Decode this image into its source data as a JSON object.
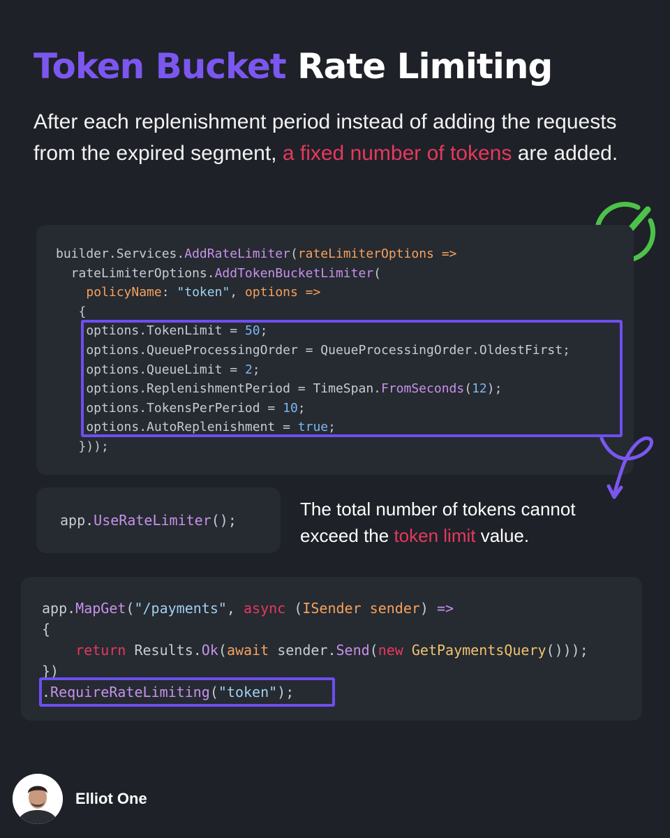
{
  "title": {
    "accent": "Token Bucket",
    "rest": "Rate Limiting"
  },
  "subtitle": {
    "part1": "After each replenishment period instead of adding the requests from the expired segment, ",
    "highlight": "a fixed number of tokens",
    "part2": " are added."
  },
  "note": {
    "part1": "The total number of tokens cannot exceed the ",
    "highlight": "token limit",
    "part2": " value."
  },
  "author": {
    "name": "Elliot One"
  },
  "colors": {
    "background": "#1e2127",
    "card": "#262a31",
    "accent_purple": "#7b57f0",
    "highlight_red": "#e5395e",
    "check_green": "#4cc24a"
  },
  "icons": [
    "check-circle-icon",
    "curly-arrow-icon"
  ],
  "code": {
    "block1": {
      "l1_obj": "builder.Services.",
      "l1_fn": "AddRateLimiter",
      "l1_paren": "(",
      "l1_param": "rateLimiterOptions =>",
      "l2_obj": "  rateLimiterOptions.",
      "l2_fn": "AddTokenBucketLimiter",
      "l2_paren": "(",
      "l3_indent": "    ",
      "l3_param": "policyName",
      "l3_colon": ": ",
      "l3_str": "\"token\"",
      "l3_comma": ", ",
      "l3_param2": "options =>",
      "l4": "   {",
      "l5_a": "    options.TokenLimit = ",
      "l5_num": "50",
      "l5_end": ";",
      "l6": "    options.QueueProcessingOrder = QueueProcessingOrder.OldestFirst;",
      "l7_a": "    options.QueueLimit = ",
      "l7_num": "2",
      "l7_end": ";",
      "l8_a": "    options.ReplenishmentPeriod = TimeSpan.",
      "l8_fn": "FromSeconds",
      "l8_p1": "(",
      "l8_num": "12",
      "l8_end": ");",
      "l9_a": "    options.TokensPerPeriod = ",
      "l9_num": "10",
      "l9_end": ";",
      "l10_a": "    options.AutoReplenishment = ",
      "l10_kw": "true",
      "l10_end": ";",
      "l11": "   }));"
    },
    "block2": {
      "obj": "app.",
      "fn": "UseRateLimiter",
      "end": "();"
    },
    "block3": {
      "l1_obj": "app.",
      "l1_fn": "MapGet",
      "l1_p": "(",
      "l1_str": "\"/payments\"",
      "l1_comma": ", ",
      "l1_kw": "async",
      "l1_sp": " (",
      "l1_type": "ISender sender",
      "l1_close": ") ",
      "l1_arrow": "=>",
      "l2": "{",
      "l3_indent": "    ",
      "l3_kw": "return",
      "l3_a": " Results.",
      "l3_fn": "Ok",
      "l3_p": "(",
      "l3_kw2": "await",
      "l3_b": " sender.",
      "l3_fn2": "Send",
      "l3_p2": "(",
      "l3_kw3": "new",
      "l3_sp": " ",
      "l3_type": "GetPaymentsQuery",
      "l3_end": "()));",
      "l4": "})",
      "l5_dot": ".",
      "l5_fn": "RequireRateLimiting",
      "l5_p": "(",
      "l5_str": "\"token\"",
      "l5_end": ");"
    }
  }
}
